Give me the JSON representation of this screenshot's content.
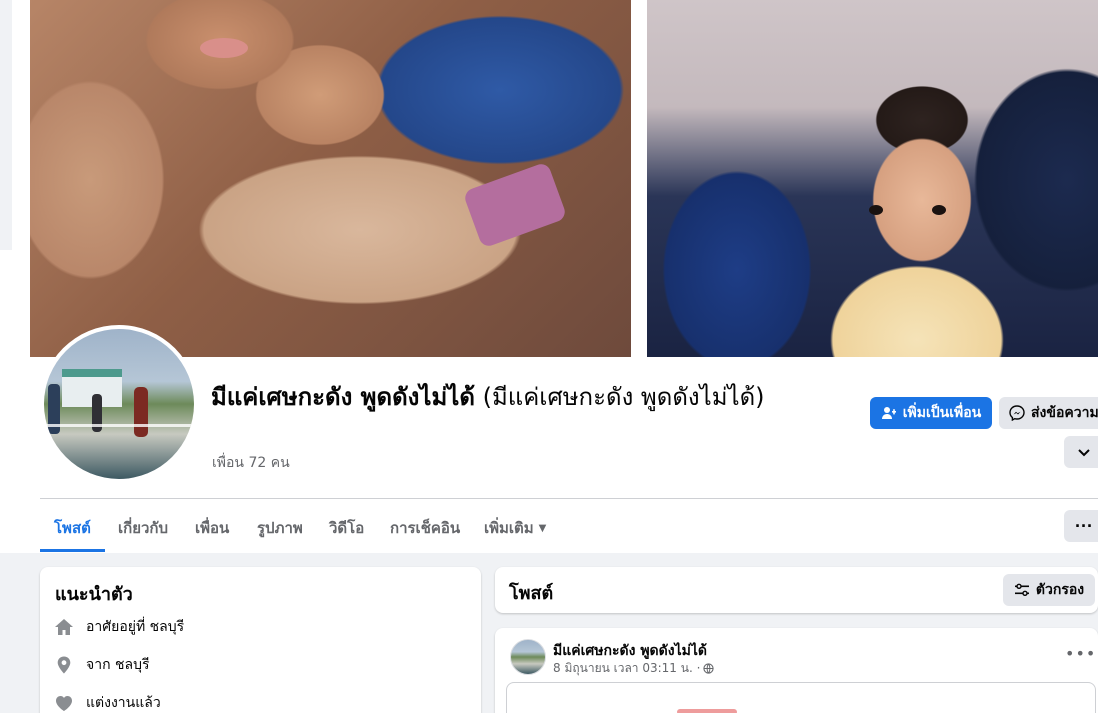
{
  "profile": {
    "name": "มีแค่เศษกะดัง พูดดังไม่ได้",
    "alt_name": "(มีแค่เศษกะดัง พูดดังไม่ได้)",
    "friends": "เพื่อน 72 คน"
  },
  "actions": {
    "add_friend": "เพิ่มเป็นเพื่อน",
    "message": "ส่งข้อความ"
  },
  "tabs": [
    {
      "label": "โพสต์",
      "active": true
    },
    {
      "label": "เกี่ยวกับ",
      "active": false
    },
    {
      "label": "เพื่อน",
      "active": false
    },
    {
      "label": "รูปภาพ",
      "active": false
    },
    {
      "label": "วิดีโอ",
      "active": false
    },
    {
      "label": "การเช็คอิน",
      "active": false
    },
    {
      "label": "เพิ่มเติม",
      "active": false
    }
  ],
  "intro": {
    "title": "แนะนำตัว",
    "lives_in": "อาศัยอยู่ที่ ชลบุรี",
    "from": "จาก ชลบุรี",
    "relationship": "แต่งงานแล้ว"
  },
  "posts": {
    "title": "โพสต์",
    "filter_label": "ตัวกรอง"
  },
  "post": {
    "author": "มีแค่เศษกะดัง พูดดังไม่ได้",
    "timestamp": "8 มิถุนายน เวลา 03:11 น. ·"
  },
  "colors": {
    "primary": "#1b74e4",
    "background": "#f0f2f5",
    "secondary_text": "#65676b",
    "button_gray": "#e4e6eb"
  },
  "icons": {
    "home": "home-icon",
    "location": "location-pin-icon",
    "heart": "heart-icon",
    "add_friend": "add-friend-icon",
    "messenger": "messenger-icon",
    "filter": "filter-icon",
    "globe": "globe-icon"
  }
}
